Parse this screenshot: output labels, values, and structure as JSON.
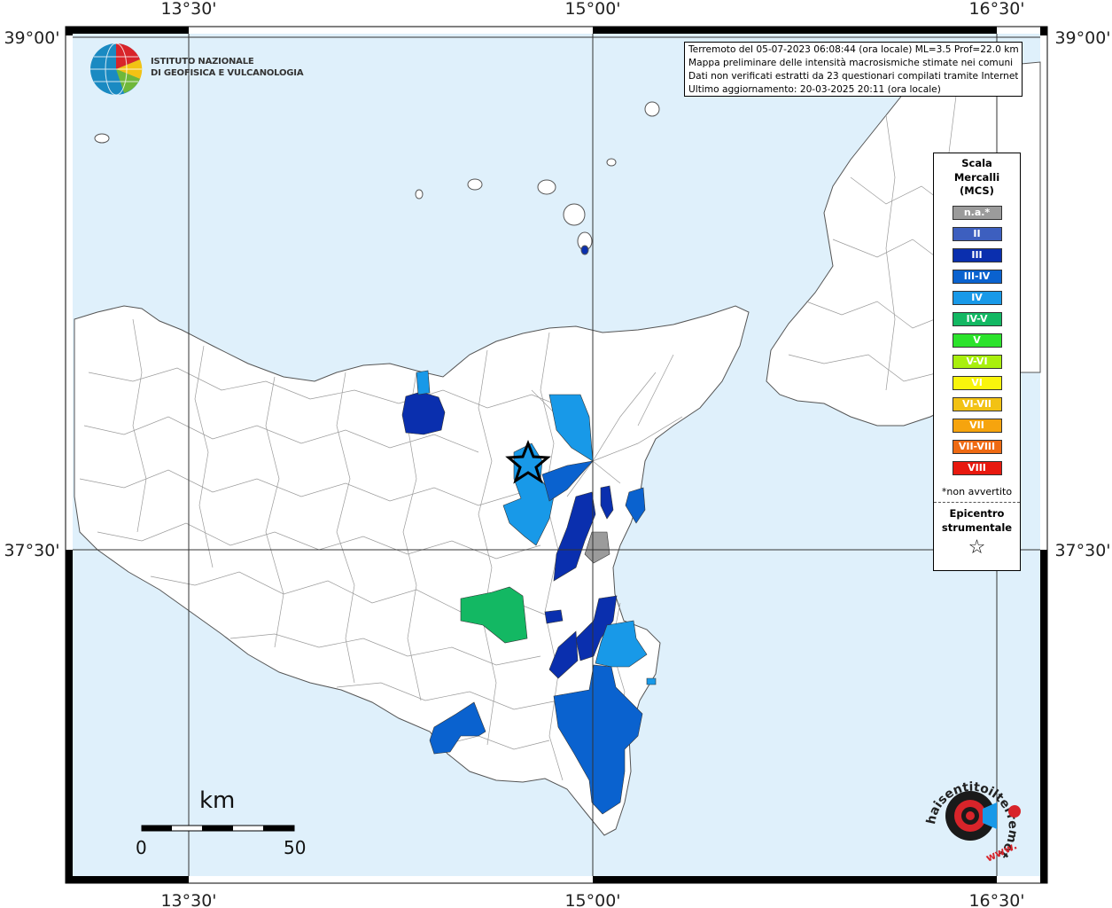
{
  "coordinates": {
    "lon_labels": [
      "13°30'",
      "15°00'",
      "16°30'"
    ],
    "lat_labels": [
      "39°00'",
      "37°30'"
    ]
  },
  "header_info": {
    "line1": "Terremoto del 05-07-2023 06:08:44 (ora locale) ML=3.5 Prof=22.0 km",
    "line2": "Mappa preliminare delle intensità macrosismiche stimate nei comuni",
    "line3": "Dati non verificati estratti da 23 questionari compilati tramite Internet.",
    "line4": "Ultimo aggiornamento: 20-03-2025 20:11 (ora locale)"
  },
  "institute": {
    "line1": "ISTITUTO NAZIONALE",
    "line2": "DI GEOFISICA E VULCANOLOGIA"
  },
  "legend": {
    "title_line1": "Scala",
    "title_line2": "Mercalli",
    "title_line3": "(MCS)",
    "items": [
      {
        "label": "n.a.*",
        "color": "#9b9b9b"
      },
      {
        "label": "II",
        "color": "#3d5fbf"
      },
      {
        "label": "III",
        "color": "#0a2fae"
      },
      {
        "label": "III-IV",
        "color": "#0a62cf"
      },
      {
        "label": "IV",
        "color": "#1899e8"
      },
      {
        "label": "IV-V",
        "color": "#13b863"
      },
      {
        "label": "V",
        "color": "#2ce32c"
      },
      {
        "label": "V-VI",
        "color": "#a9ef0d"
      },
      {
        "label": "VI",
        "color": "#f9f50c"
      },
      {
        "label": "VI-VII",
        "color": "#f2c214"
      },
      {
        "label": "VII",
        "color": "#f6a40e"
      },
      {
        "label": "VII-VIII",
        "color": "#ef6a12"
      },
      {
        "label": "VIII",
        "color": "#e8190f"
      }
    ],
    "note": "*non avvertito",
    "epicenter_line1": "Epicentro",
    "epicenter_line2": "strumentale",
    "star_symbol": "☆"
  },
  "scale_bar": {
    "unit": "km",
    "min": "0",
    "max": "50"
  },
  "colors": {
    "sea": "#dff0fb",
    "land": "#ffffff",
    "grid": "#333333"
  },
  "branding": {
    "circle_text": "haisentitoilterremoto.it",
    "url_text": "www."
  }
}
